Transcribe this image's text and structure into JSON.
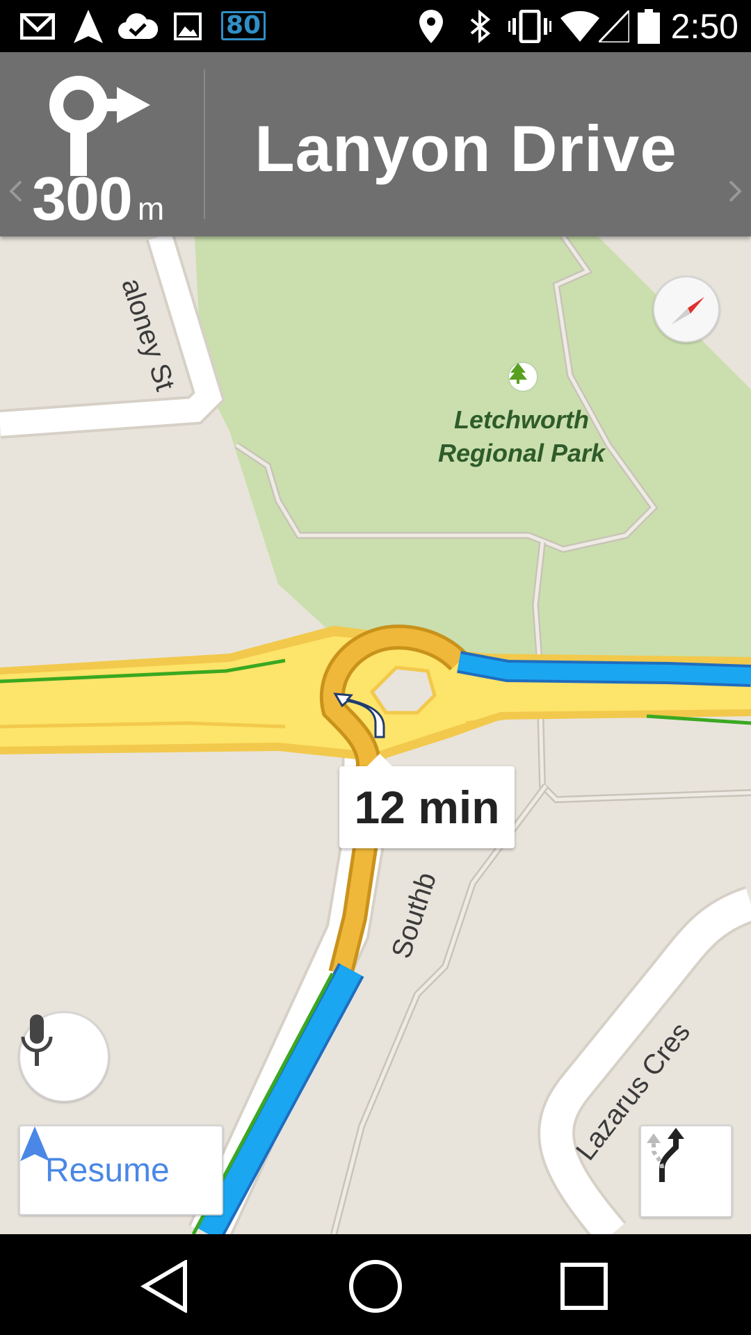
{
  "status_bar": {
    "icons": [
      "gmail-icon",
      "navigation-icon",
      "cloud-check-icon",
      "image-icon"
    ],
    "badge": "80",
    "right_icons": [
      "location-pin-icon",
      "bluetooth-icon",
      "vibrate-icon",
      "wifi-icon",
      "cell-signal-icon",
      "battery-icon"
    ],
    "time": "2:50"
  },
  "header": {
    "maneuver_icon": "roundabout-right-icon",
    "distance_value": "300",
    "distance_unit": "m",
    "street": "Lanyon Drive",
    "background_color": "#6f6f6f"
  },
  "map": {
    "park_name_line1": "Letchworth",
    "park_name_line2": "Regional Park",
    "street_labels": {
      "maloney": "aloney St",
      "southb": "Southb",
      "lazarus": "Lazarus Cres"
    },
    "eta": "12 min",
    "route_color": "#1aa6f0",
    "road_color": "#fde46a"
  },
  "controls": {
    "resume_label": "Resume",
    "mic_icon": "microphone-icon",
    "compass_icon": "compass-icon",
    "route_options_icon": "alternate-routes-icon"
  },
  "nav_bar": {
    "back": "back-icon",
    "home": "home-icon",
    "recents": "recents-icon"
  }
}
